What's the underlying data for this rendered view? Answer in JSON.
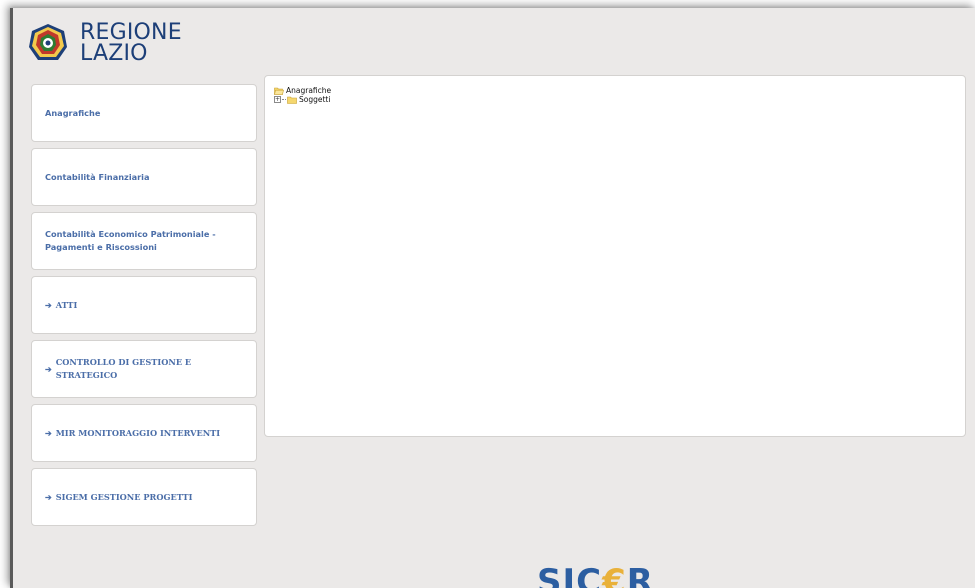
{
  "header": {
    "logo_line1": "REGIONE",
    "logo_line2": "LAZIO",
    "emblem_icon": "regione-lazio-emblem"
  },
  "menu": {
    "items": [
      {
        "label": "Anagrafiche",
        "arrow": false
      },
      {
        "label": "Contabilità Finanziaria",
        "arrow": false
      },
      {
        "label": "Contabilità Economico Patrimoniale - Pagamenti e Riscossioni",
        "arrow": false
      },
      {
        "label": "ATTI",
        "arrow": true
      },
      {
        "label": "CONTROLLO DI GESTIONE E STRATEGICO",
        "arrow": true
      },
      {
        "label": "MIR MONITORAGGIO INTERVENTI",
        "arrow": true
      },
      {
        "label": "SIGEM GESTIONE PROGETTI",
        "arrow": true
      }
    ]
  },
  "tree": {
    "root": "Anagrafiche",
    "children": [
      "Soggetti"
    ]
  },
  "footer": {
    "brand_part1": "SIC",
    "brand_euro": "€",
    "brand_part2": "R"
  },
  "colors": {
    "menu_text": "#4b6ea8",
    "logo_text": "#1d3f78",
    "brand_blue": "#2c5ea1",
    "brand_gold": "#e9b13a",
    "background": "#ebe9e8"
  }
}
